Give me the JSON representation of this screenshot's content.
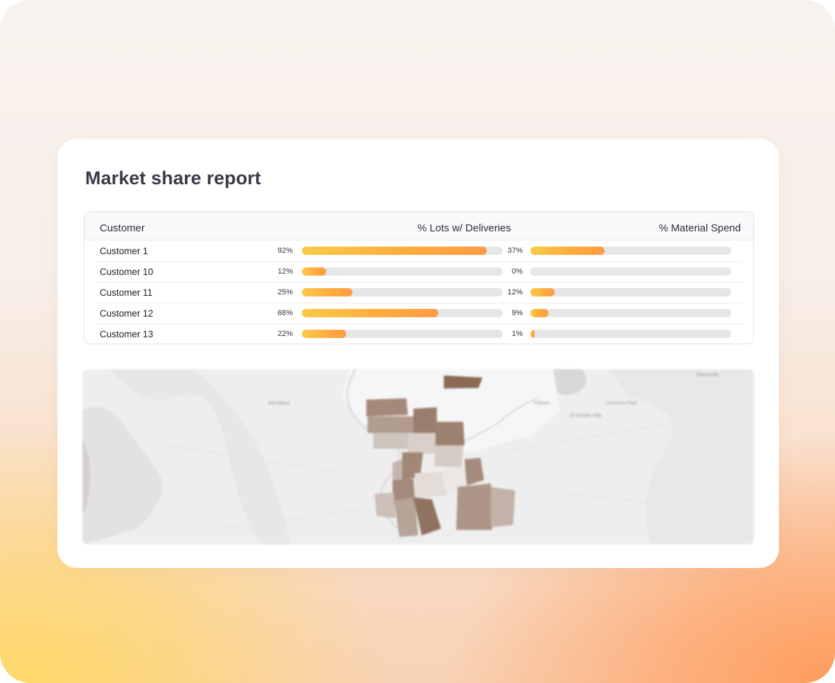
{
  "report": {
    "title": "Market share report"
  },
  "table": {
    "headers": {
      "customer": "Customer",
      "lots": "% Lots w/ Deliveries",
      "spend": "% Material Spend"
    },
    "rows": [
      {
        "customer": "Customer 1",
        "lots_label": "92%",
        "lots": 0.92,
        "spend_label": "37%",
        "spend": 0.37
      },
      {
        "customer": "Customer 10",
        "lots_label": "12%",
        "lots": 0.12,
        "spend_label": "0%",
        "spend": 0.0
      },
      {
        "customer": "Customer 11",
        "lots_label": "25%",
        "lots": 0.25,
        "spend_label": "12%",
        "spend": 0.12
      },
      {
        "customer": "Customer 12",
        "lots_label": "68%",
        "lots": 0.68,
        "spend_label": "9%",
        "spend": 0.09
      },
      {
        "customer": "Customer 13",
        "lots_label": "22%",
        "lots": 0.22,
        "spend_label": "1%",
        "spend": 0.01
      }
    ]
  },
  "map": {
    "place_labels": [
      "Placerville",
      "Woodland",
      "Folsom",
      "Cameron Park",
      "El Dorado Hills"
    ]
  },
  "colors": {
    "bar_start": "#f9c94a",
    "bar_end": "#ff9a45",
    "track": "#e6e5e8",
    "choropleth_dark": "#8a6a55",
    "choropleth_light": "#d9d0c9"
  }
}
